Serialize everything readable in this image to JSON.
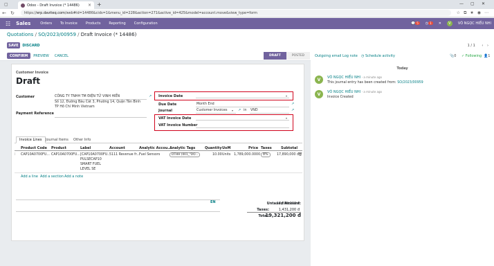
{
  "browser": {
    "tab_title": "Odoo - Draft Invoice (* 14486)",
    "url_prefix": "https://",
    "url_host": "erp.daviteq.com",
    "url_path": "/web#id=14486&cids=1&menu_id=228&action=271&active_id=425&model=account.move&view_type=form"
  },
  "navbar": {
    "app_name": "Sales",
    "menu": [
      "Orders",
      "To Invoice",
      "Products",
      "Reporting",
      "Configuration"
    ],
    "chat_badge": "5",
    "activity_badge": "1",
    "user": "VÕ NGỌC HIẾU NHI",
    "company": "V"
  },
  "breadcrumb": {
    "part1": "Quotations",
    "part2": "SO/2023/00959",
    "current": "Draft Invoice (* 14486)"
  },
  "actions": {
    "save": "SAVE",
    "discard": "DISCARD"
  },
  "pager": "1 / 1",
  "statusbar": {
    "confirm": "CONFIRM",
    "preview": "PREVIEW",
    "cancel": "CANCEL",
    "stages": [
      "DRAFT",
      "POSTED"
    ]
  },
  "form": {
    "type_label": "Customer Invoice",
    "state": "Draft",
    "customer_label": "Customer",
    "customer_name": "CÔNG TY TNHH TM ĐIỆN TỬ VINH HIỂN",
    "customer_addr1": "Số 12, Đường Bàu Cát 3, Phường 14, Quận Tân Bình",
    "customer_addr2": "TP Hồ Chí Minh Vietnam",
    "payment_ref_label": "Payment Reference",
    "invoice_date_label": "Invoice Date",
    "due_date_label": "Due Date",
    "due_date_value": "Month End",
    "journal_label": "Journal",
    "journal_value": "Customer Invoices",
    "journal_in": "in",
    "currency": "VND",
    "vat_date_label": "VAT Invoice Date",
    "vat_number_label": "VAT Invoice Number"
  },
  "tabs": [
    "Invoice Lines",
    "Journal Items",
    "Other Info"
  ],
  "table": {
    "headers": [
      "Product Code",
      "Product",
      "Label",
      "Account",
      "Analytic Accou...",
      "Analytic Tags",
      "Quantity",
      "UoM",
      "Price",
      "Taxes",
      "Subtotal"
    ],
    "row": {
      "code": "CAP10A0700FU...",
      "product": "CAP10A0700FU...",
      "label_lines": [
        "[CAP10A0700FU...",
        "PULSECAP10",
        "SMART FUEL",
        "LEVEL SE"
      ],
      "account": "5111 Revenue fr...",
      "analytic": "Fuel Sensors",
      "tag": "DTHH (001_\"DO...",
      "qty": "10.00",
      "uom": "Units",
      "price": "1,789,000.0000",
      "tax": "8%",
      "subtotal": "17,890,000 đ"
    },
    "add_line": "Add a line",
    "add_section": "Add a section",
    "add_note": "Add a note"
  },
  "totals": {
    "lang": "EN",
    "untaxed_label": "Untaxed Amount:",
    "untaxed_value": "17,890,000 đ",
    "taxes_label": "Taxes:",
    "taxes_value": "1,431,200 đ",
    "total_label": "Total:",
    "total_value": "19,321,200 đ"
  },
  "chatter": {
    "outgoing": "Outgoing email",
    "log_note": "Log note",
    "schedule": "Schedule activity",
    "attach_count": "0",
    "following": "Following",
    "followers": "1",
    "today": "Today",
    "messages": [
      {
        "author": "VÕ NGỌC HIẾU NHI",
        "time": "- a minute ago",
        "body": "This journal entry has been created from:",
        "link": "SO/2023/00959"
      },
      {
        "author": "VÕ NGỌC HIẾU NHI",
        "time": "- a minute ago",
        "body": "Invoice Created",
        "link": ""
      }
    ]
  }
}
